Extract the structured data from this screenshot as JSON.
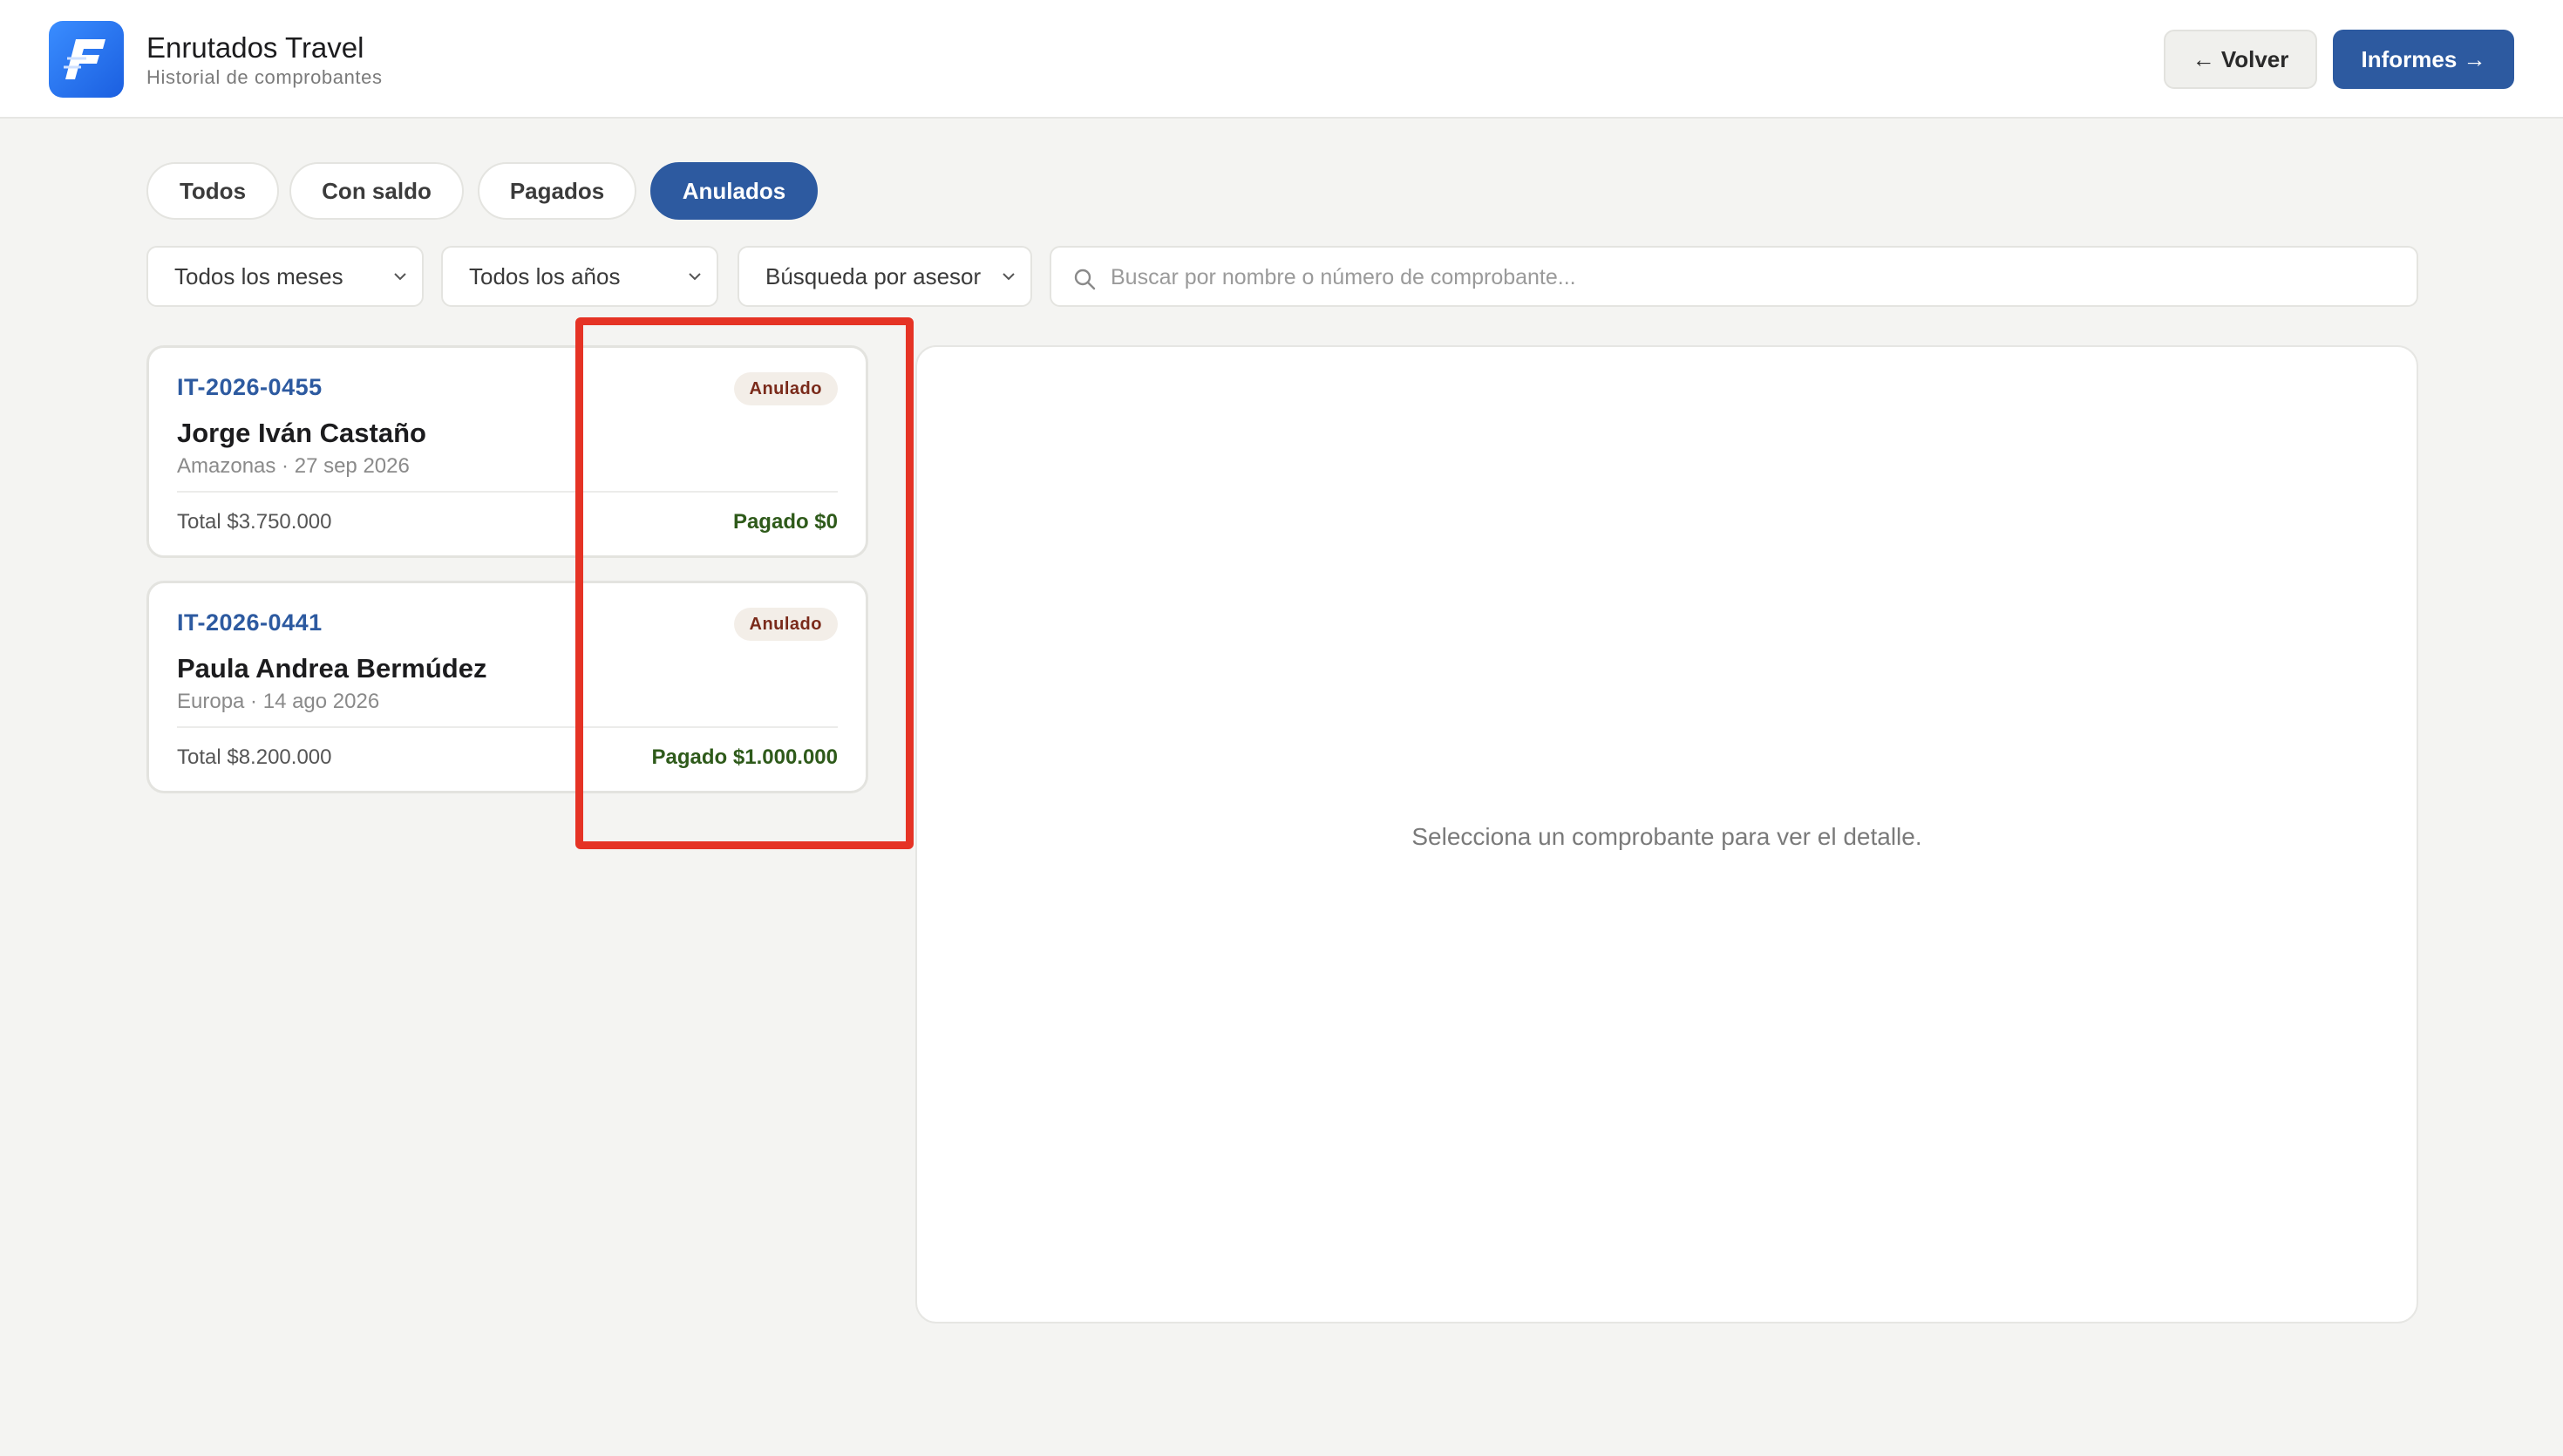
{
  "header": {
    "title": "Enrutados Travel",
    "subtitle": "Historial de comprobantes",
    "back_label": "← Volver",
    "reports_label": "Informes →"
  },
  "tabs": [
    {
      "label": "Todos",
      "active": false
    },
    {
      "label": "Con saldo",
      "active": false
    },
    {
      "label": "Pagados",
      "active": false
    },
    {
      "label": "Anulados",
      "active": true
    }
  ],
  "filters": {
    "month": "Todos los meses",
    "year": "Todos los años",
    "advisor": "Búsqueda por asesor",
    "search_placeholder": "Buscar por nombre o número de comprobante..."
  },
  "vouchers": [
    {
      "code": "IT-2026-0455",
      "status": "Anulado",
      "name": "Jorge Iván Castaño",
      "meta": "Amazonas · 27 sep 2026",
      "total": "Total $3.750.000",
      "paid": "Pagado $0"
    },
    {
      "code": "IT-2026-0441",
      "status": "Anulado",
      "name": "Paula Andrea Bermúdez",
      "meta": "Europa · 14 ago 2026",
      "total": "Total $8.200.000",
      "paid": "Pagado $1.000.000"
    }
  ],
  "detail": {
    "empty_message": "Selecciona un comprobante para ver el detalle."
  },
  "colors": {
    "primary": "#2d5aa0",
    "badge_text": "#7a2a1a",
    "paid_text": "#2e5a1a",
    "highlight": "#e53325"
  }
}
